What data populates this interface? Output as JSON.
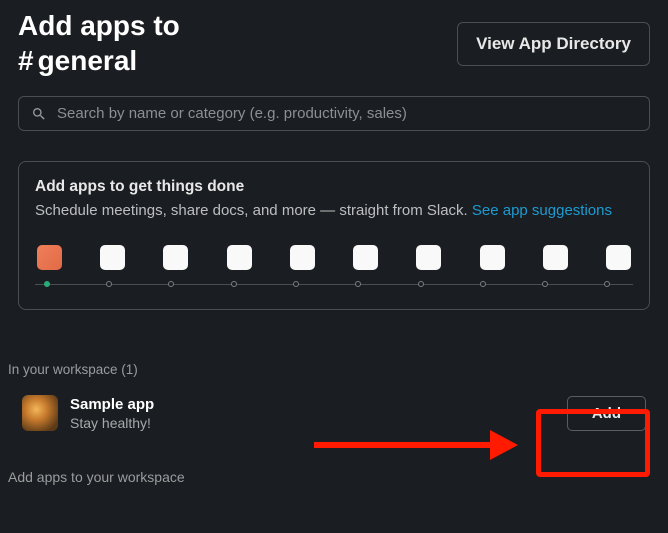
{
  "header": {
    "title_line1": "Add apps to",
    "channel_name": "general",
    "view_directory_label": "View App Directory"
  },
  "search": {
    "placeholder": "Search by name or category (e.g. productivity, sales)"
  },
  "promo": {
    "title": "Add apps to get things done",
    "subtitle_prefix": "Schedule meetings, share docs, and more — straight from Slack. ",
    "link_label": "See app suggestions"
  },
  "workspace": {
    "section_label": "In your workspace (1)",
    "apps": [
      {
        "name": "Sample app",
        "desc": "Stay healthy!",
        "add_label": "Add"
      }
    ]
  },
  "footer": {
    "label": "Add apps to your workspace"
  }
}
